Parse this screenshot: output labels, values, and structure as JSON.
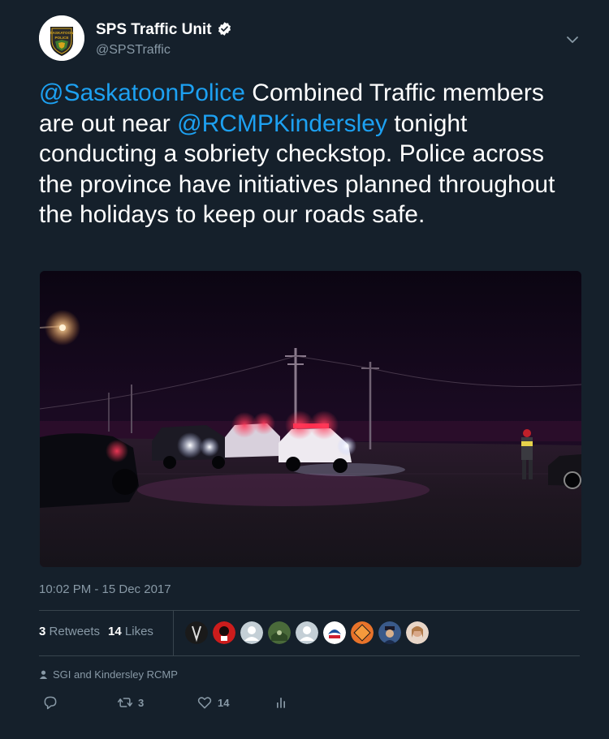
{
  "tweet": {
    "author_name": "SPS Traffic Unit",
    "author_handle": "@SPSTraffic",
    "text_parts": {
      "mention1": "@SaskatoonPolice",
      "t1": " Combined Traffic members are out near ",
      "mention2": "@RCMPKindersley",
      "t2": " tonight conducting a sobriety checkstop. Police across the province have initiatives planned throughout the holidays to keep our roads safe."
    },
    "timestamp": "10:02 PM - 15 Dec 2017",
    "retweets_count": "3",
    "retweets_label": "Retweets",
    "likes_count": "14",
    "likes_label": "Likes",
    "tagged_people": "SGI and Kindersley RCMP",
    "action_retweet_count": "3",
    "action_like_count": "14"
  },
  "avatar_logo": {
    "line1": "SASKATOON",
    "line2": "POLICE"
  },
  "icons": {
    "verified": "verified-badge-icon",
    "caret": "chevron-down-icon",
    "reply": "reply-icon",
    "retweet": "retweet-icon",
    "like": "heart-icon",
    "analytics": "analytics-icon",
    "person": "person-icon"
  },
  "colors": {
    "background": "#15202b",
    "link": "#1da1f2",
    "secondary_text": "#8899a6",
    "divider": "#38444d"
  }
}
